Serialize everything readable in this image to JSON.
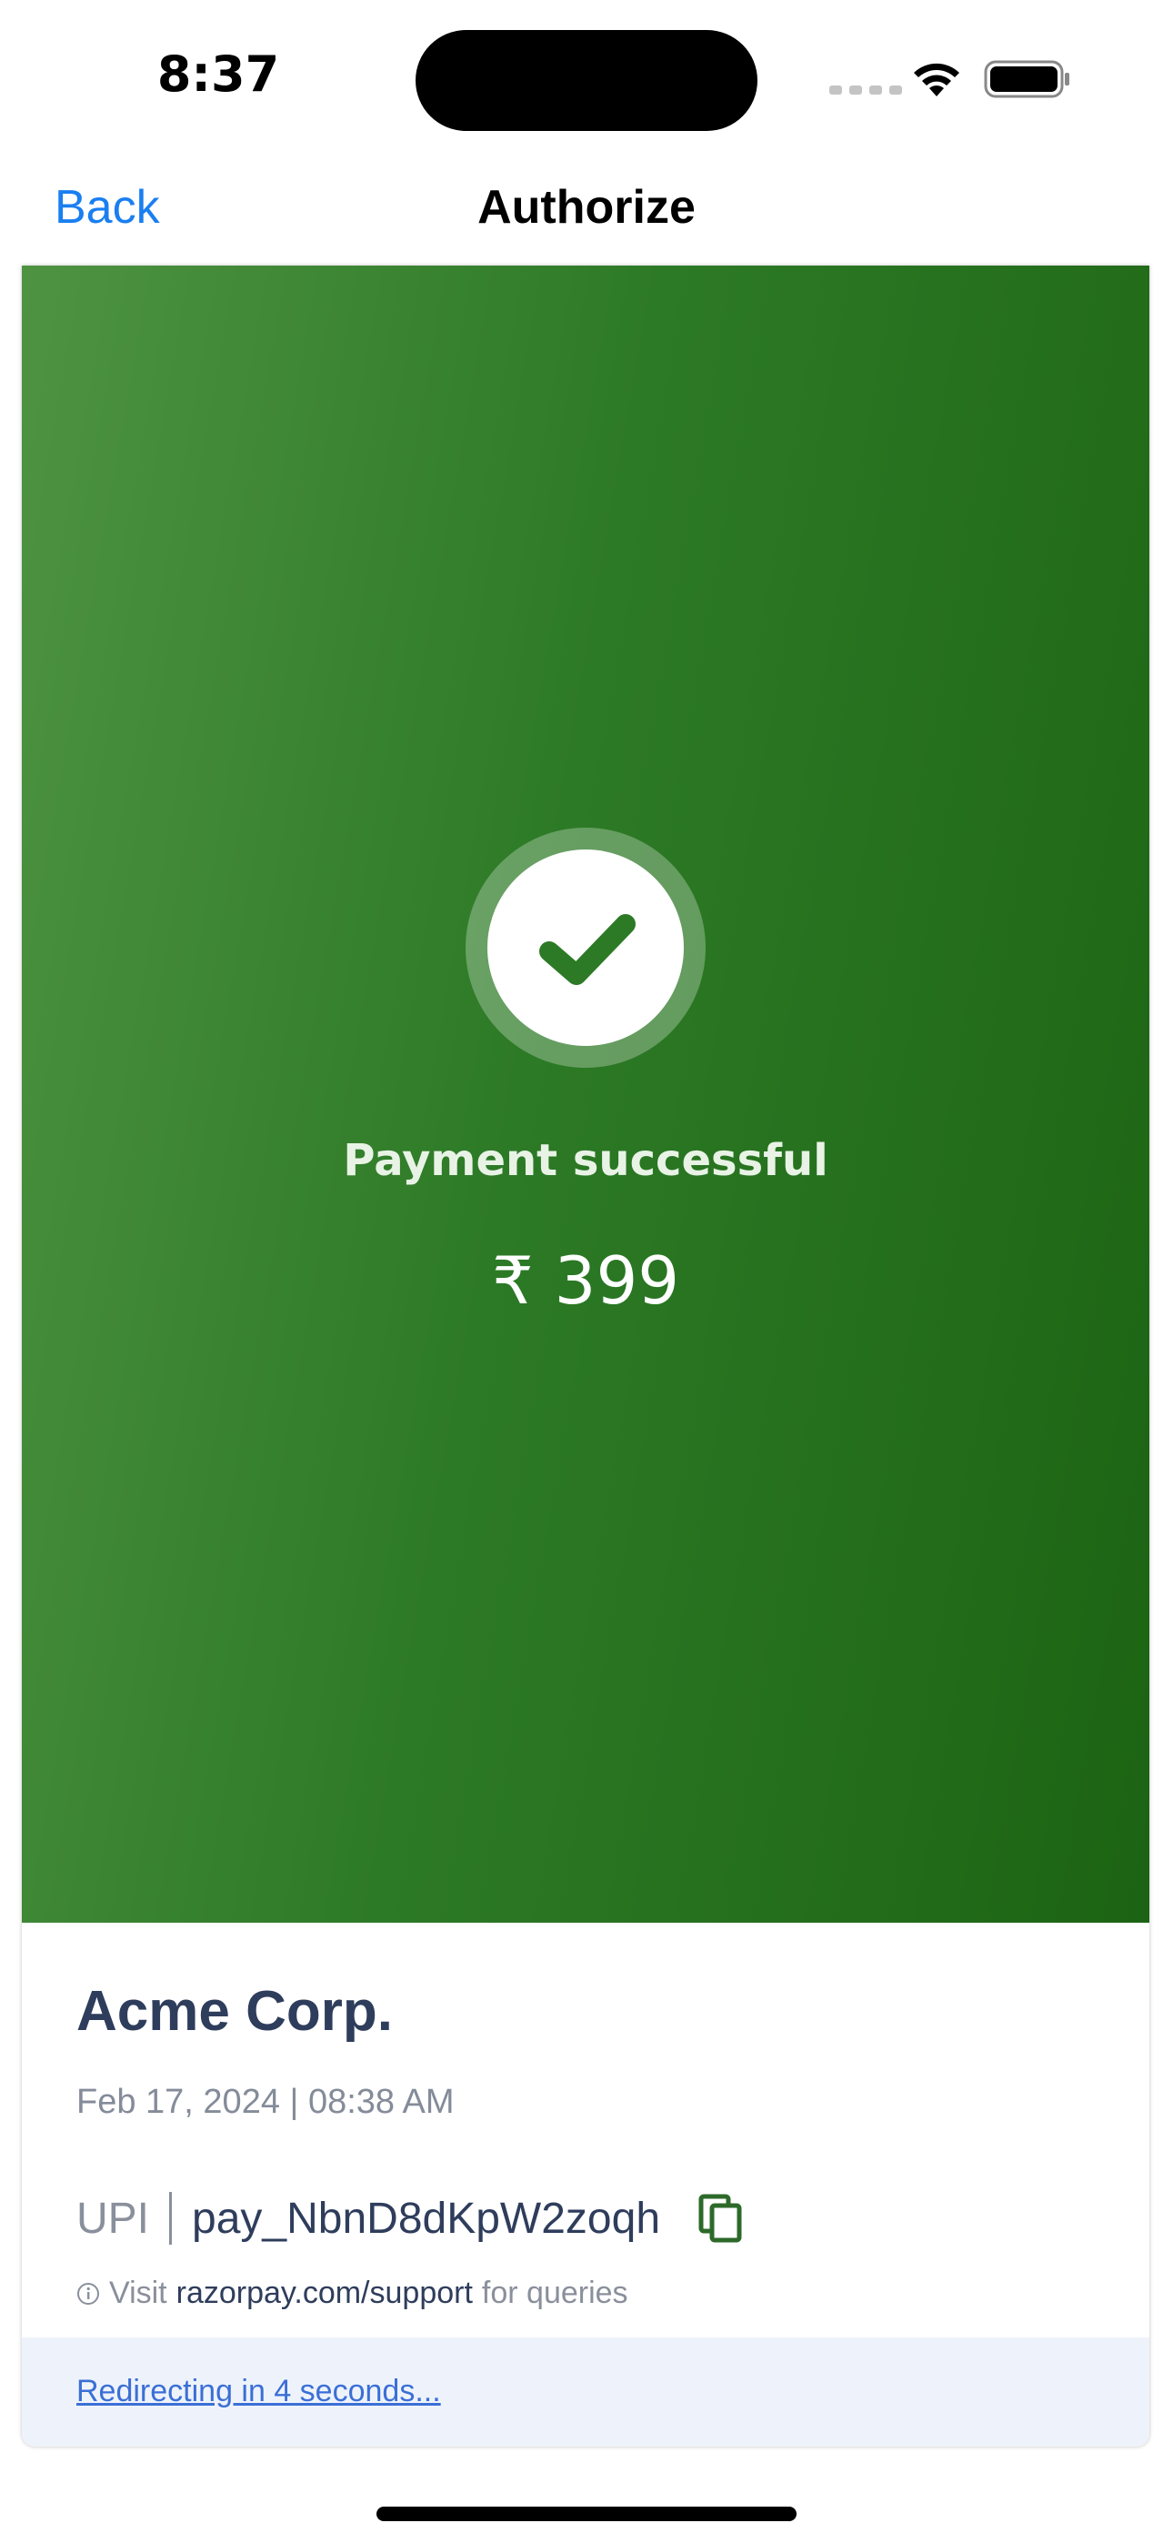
{
  "status_bar": {
    "time": "8:37"
  },
  "nav": {
    "back_label": "Back",
    "title": "Authorize"
  },
  "payment": {
    "status_text": "Payment successful",
    "amount": "₹ 399",
    "merchant": "Acme Corp.",
    "datetime": "Feb 17, 2024 | 08:38 AM",
    "method": "UPI",
    "payment_id": "pay_NbnD8dKpW2zoqh",
    "support_prefix": "Visit",
    "support_link": "razorpay.com/support",
    "support_suffix": "for queries",
    "redirect_text": "Redirecting in 4 seconds..."
  },
  "icons": {
    "check": "check-icon",
    "copy": "copy-icon",
    "info": "info-icon",
    "wifi": "wifi-icon",
    "battery": "battery-icon"
  },
  "colors": {
    "accent_blue": "#1a7ff0",
    "success_green_light": "#4e9342",
    "success_green_dark": "#1c6413",
    "text_dark": "#2f3d5c",
    "text_muted": "#8a8f9c",
    "link_blue": "#3b6fd6"
  }
}
